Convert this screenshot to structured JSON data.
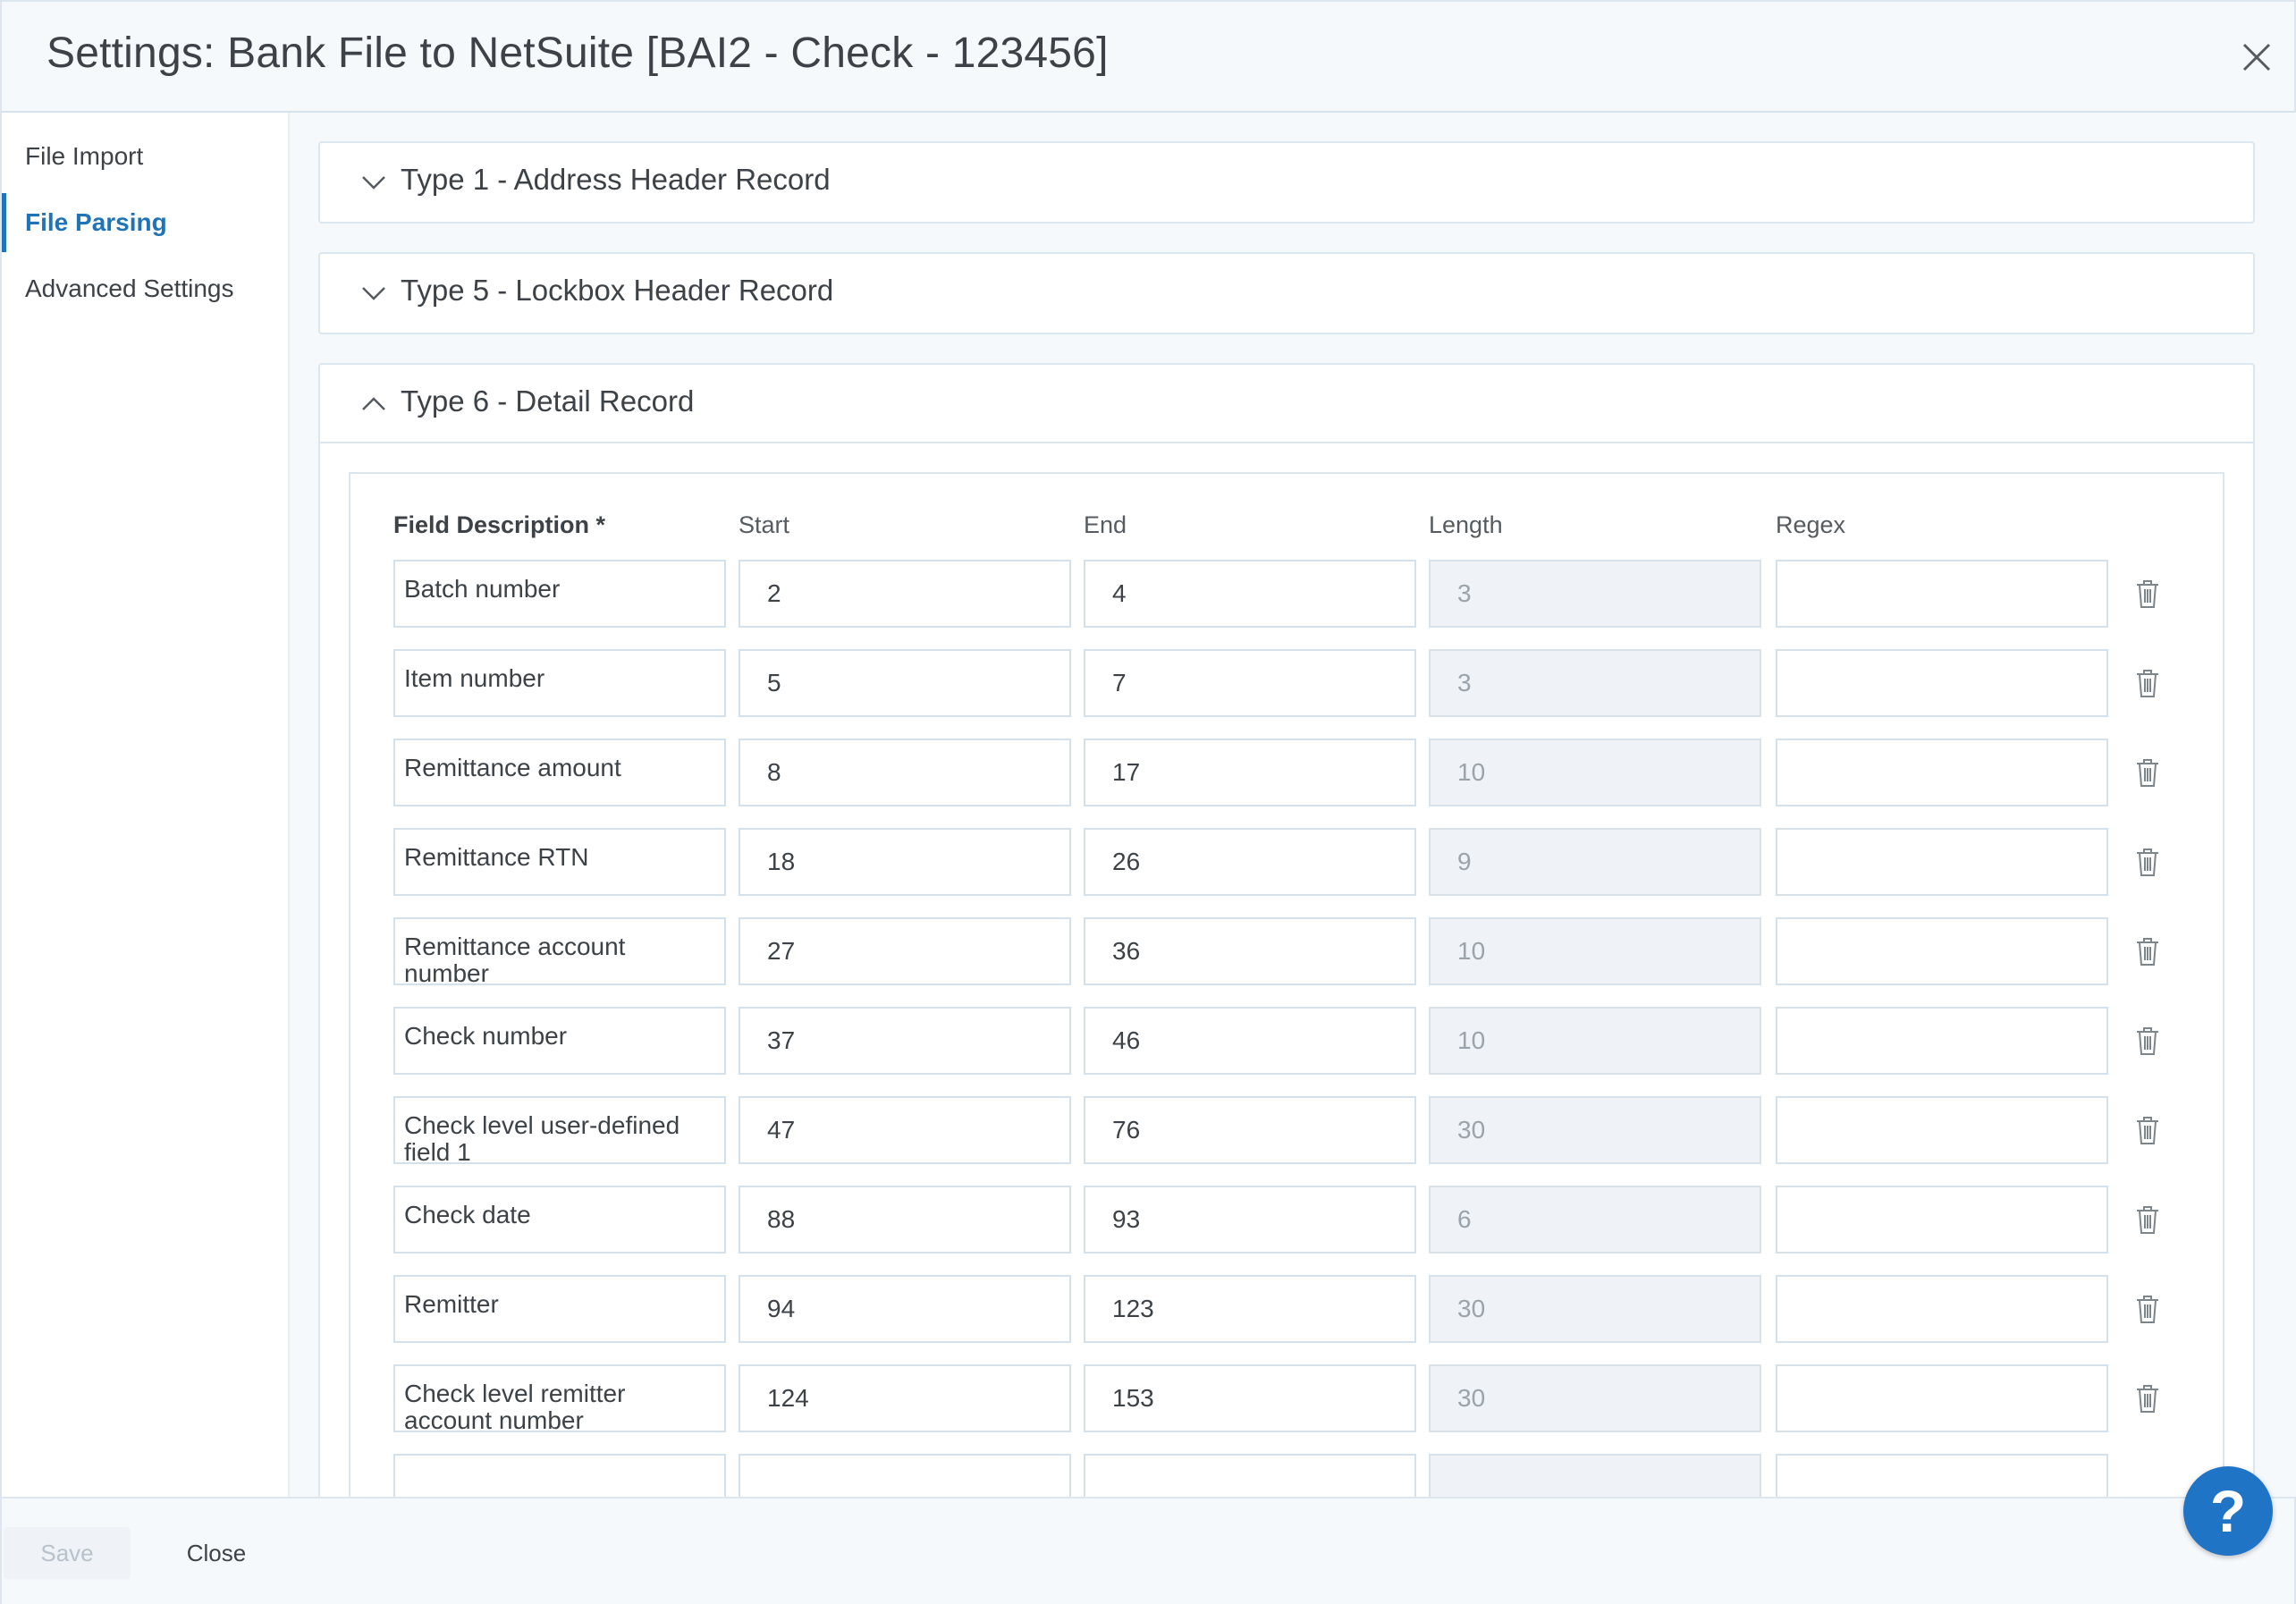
{
  "window": {
    "title": "Settings: Bank File to NetSuite [BAI2 - Check - 123456]",
    "close_icon": "close-icon"
  },
  "sidebar": {
    "items": [
      {
        "label": "File Import",
        "active": false
      },
      {
        "label": "File Parsing",
        "active": true
      },
      {
        "label": "Advanced Settings",
        "active": false
      }
    ]
  },
  "panels": [
    {
      "title": "Type 1 - Address Header Record",
      "expanded": false
    },
    {
      "title": "Type 5 - Lockbox Header Record",
      "expanded": false
    },
    {
      "title": "Type 6 - Detail Record",
      "expanded": true
    }
  ],
  "table": {
    "headers": {
      "description": "Field Description *",
      "start": "Start",
      "end": "End",
      "length": "Length",
      "regex": "Regex"
    },
    "rows": [
      {
        "description": "Batch number",
        "start": "2",
        "end": "4",
        "length": "3",
        "regex": ""
      },
      {
        "description": "Item number",
        "start": "5",
        "end": "7",
        "length": "3",
        "regex": ""
      },
      {
        "description": "Remittance amount",
        "start": "8",
        "end": "17",
        "length": "10",
        "regex": ""
      },
      {
        "description": "Remittance RTN",
        "start": "18",
        "end": "26",
        "length": "9",
        "regex": ""
      },
      {
        "description": "Remittance account number",
        "start": "27",
        "end": "36",
        "length": "10",
        "regex": ""
      },
      {
        "description": "Check number",
        "start": "37",
        "end": "46",
        "length": "10",
        "regex": ""
      },
      {
        "description": "Check level user-defined field 1",
        "start": "47",
        "end": "76",
        "length": "30",
        "regex": ""
      },
      {
        "description": "Check date",
        "start": "88",
        "end": "93",
        "length": "6",
        "regex": ""
      },
      {
        "description": "Remitter",
        "start": "94",
        "end": "123",
        "length": "30",
        "regex": ""
      },
      {
        "description": "Check level remitter account number",
        "start": "124",
        "end": "153",
        "length": "30",
        "regex": ""
      },
      {
        "description": "",
        "start": "",
        "end": "",
        "length": "",
        "regex": ""
      }
    ]
  },
  "footer": {
    "save_label": "Save",
    "close_label": "Close"
  },
  "help": {
    "label": "?"
  },
  "colors": {
    "accent": "#1f74b8",
    "help_button": "#1f74c6"
  }
}
